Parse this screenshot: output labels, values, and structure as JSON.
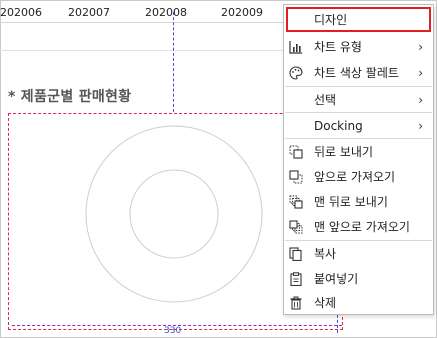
{
  "x_categories": [
    "202006",
    "202007",
    "202008",
    "202009"
  ],
  "chart": {
    "title": "* 제품군별 판매현황",
    "width_label": "330"
  },
  "context_menu": {
    "items": [
      {
        "label": "디자인",
        "icon": "",
        "submenu": false
      },
      {
        "label": "차트 유형",
        "icon": "bar-chart-icon",
        "submenu": true
      },
      {
        "label": "차트 색상 팔레트",
        "icon": "palette-icon",
        "submenu": true
      },
      {
        "label": "선택",
        "icon": "",
        "submenu": true
      },
      {
        "label": "Docking",
        "icon": "",
        "submenu": true
      },
      {
        "label": "뒤로 보내기",
        "icon": "send-backward-icon",
        "submenu": false
      },
      {
        "label": "앞으로 가져오기",
        "icon": "bring-forward-icon",
        "submenu": false
      },
      {
        "label": "맨 뒤로 보내기",
        "icon": "send-to-back-icon",
        "submenu": false
      },
      {
        "label": "맨 앞으로 가져오기",
        "icon": "bring-to-front-icon",
        "submenu": false
      },
      {
        "label": "복사",
        "icon": "copy-icon",
        "submenu": false
      },
      {
        "label": "붙여넣기",
        "icon": "paste-icon",
        "submenu": false
      },
      {
        "label": "삭제",
        "icon": "trash-icon",
        "submenu": false
      }
    ],
    "chevron": "›"
  },
  "colors": {
    "selection_outline": "#e0294a",
    "guide_line": "#4a4ad8",
    "highlight_border": "#e02020"
  }
}
